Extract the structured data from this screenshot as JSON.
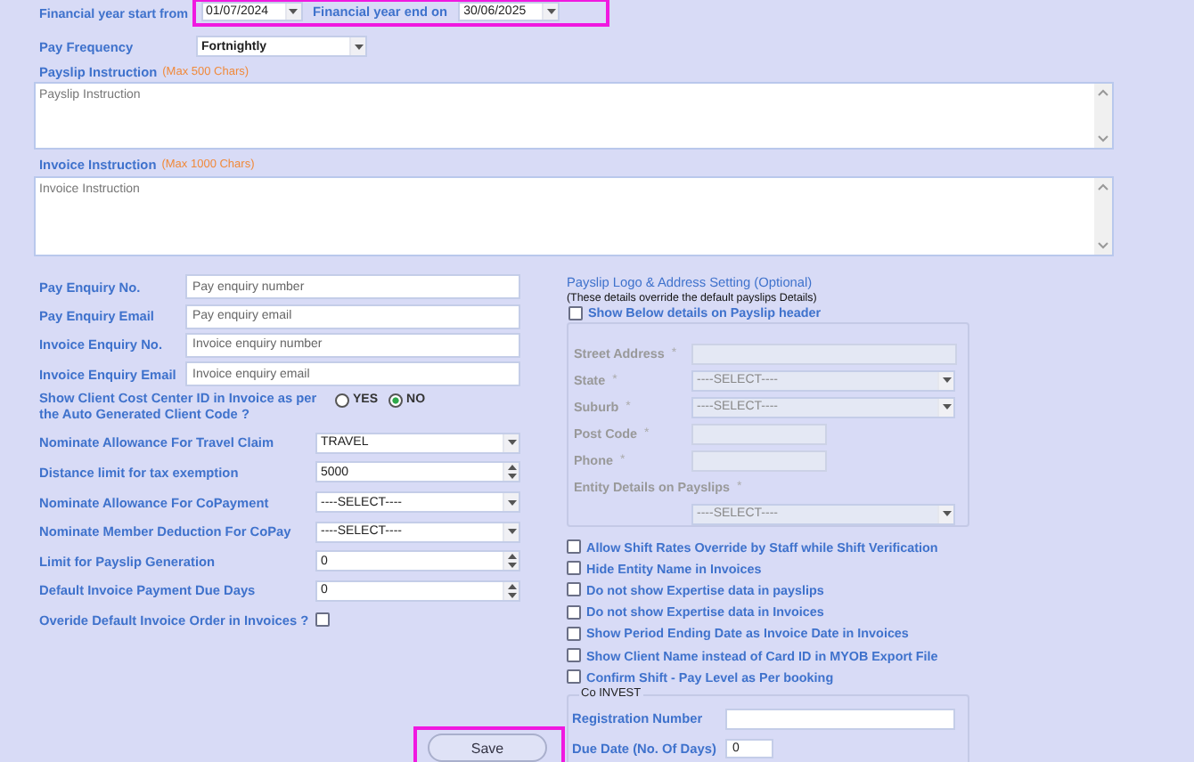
{
  "financial_year": {
    "start_label": "Financial year start from",
    "start_value": "01/07/2024",
    "end_label": "Financial year end on",
    "end_value": "30/06/2025",
    "highlighted": true
  },
  "pay_frequency": {
    "label": "Pay Frequency",
    "value": "Fortnightly"
  },
  "instructions": [
    {
      "label": "Payslip Instruction",
      "limit": "(Max 500  Chars)",
      "placeholder": "Payslip Instruction",
      "kind": "short"
    },
    {
      "label": "Invoice Instruction",
      "limit": "(Max 1000  Chars)",
      "placeholder": "Invoice Instruction",
      "kind": "tall"
    }
  ],
  "settings": [
    {
      "kind": "text",
      "label": "Pay Enquiry No.",
      "placeholder": "Pay enquiry number"
    },
    {
      "kind": "text",
      "label": "Pay Enquiry Email",
      "placeholder": "Pay enquiry email"
    },
    {
      "kind": "text",
      "label": "Invoice Enquiry No.",
      "placeholder": "Invoice enquiry number"
    },
    {
      "kind": "text",
      "label": "Invoice Enquiry Email",
      "placeholder": "Invoice enquiry email"
    },
    {
      "kind": "radio",
      "label": "Show Client Cost Center ID in Invoice as per the Auto Generated Client Code ?",
      "options": [
        {
          "label": "YES",
          "selected": false
        },
        {
          "label": "NO",
          "selected": true
        }
      ]
    },
    {
      "kind": "select",
      "label": "Nominate Allowance For Travel Claim",
      "value": "TRAVEL"
    },
    {
      "kind": "spin",
      "label": "Distance limit for tax exemption",
      "value": "5000"
    },
    {
      "kind": "select",
      "label": "Nominate Allowance For CoPayment",
      "value": "----SELECT----"
    },
    {
      "kind": "select",
      "label": "Nominate Member Deduction For CoPay",
      "value": "----SELECT----"
    },
    {
      "kind": "spin",
      "label": "Limit for Payslip Generation",
      "value": "0"
    },
    {
      "kind": "spin",
      "label": "Default Invoice Payment Due Days",
      "value": "0"
    },
    {
      "kind": "checkbox",
      "label": "Overide Default Invoice Order in Invoices ?",
      "checked": false
    }
  ],
  "payslip_logo": {
    "title": "Payslip Logo & Address Setting (Optional)",
    "note": "(These details override the default payslips Details)",
    "show_label": "Show Below details on Payslip header",
    "show_checked": false,
    "disabled": true,
    "fields": [
      {
        "kind": "text-wide",
        "label": "Street Address",
        "marker": "*"
      },
      {
        "kind": "select",
        "label": "State",
        "marker": "*",
        "value": "----SELECT----"
      },
      {
        "kind": "select",
        "label": "Suburb",
        "marker": "*",
        "value": "----SELECT----"
      },
      {
        "kind": "text-short",
        "label": "Post Code",
        "marker": "*"
      },
      {
        "kind": "text-short",
        "label": "Phone",
        "marker": "*"
      },
      {
        "kind": "select-below",
        "label": "Entity Details on Payslips",
        "marker": "*",
        "value": "----SELECT----"
      }
    ]
  },
  "options": [
    {
      "label": "Allow Shift Rates Override by Staff while Shift Verification",
      "checked": false
    },
    {
      "label": "Hide Entity Name in Invoices",
      "checked": false
    },
    {
      "label": "Do not show Expertise data in payslips",
      "checked": false
    },
    {
      "label": "Do not show Expertise data in Invoices",
      "checked": false
    },
    {
      "label": "Show Period Ending Date as Invoice Date in Invoices",
      "checked": false
    },
    {
      "label": "Show Client Name instead of Card ID in MYOB Export File",
      "checked": false
    },
    {
      "label": "Confirm Shift - Pay Level as Per booking",
      "checked": false
    }
  ],
  "co_invest": {
    "legend": "Co INVEST",
    "fields": [
      {
        "kind": "wide",
        "label": "Registration Number"
      },
      {
        "kind": "narrow",
        "label": "Due Date (No. Of Days)",
        "value": "0"
      }
    ]
  },
  "save_button": {
    "label": "Save",
    "highlighted": true
  }
}
